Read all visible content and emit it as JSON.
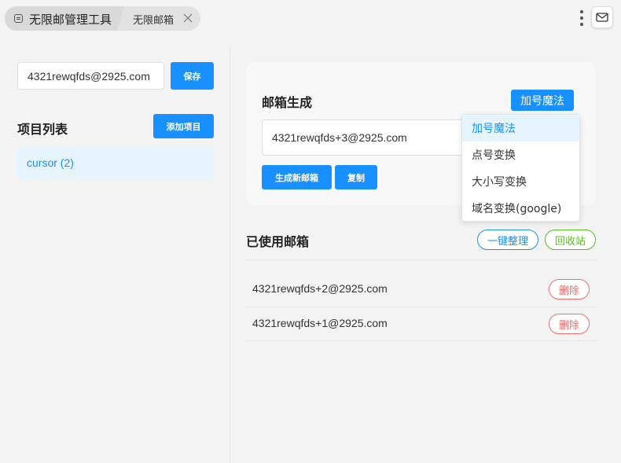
{
  "tabs": {
    "main_label": "无限邮管理工具",
    "sub_label": "无限邮箱"
  },
  "sidebar": {
    "email_value": "4321rewqfds@2925.com",
    "save_label": "保存",
    "projects_title": "项目列表",
    "add_project_label": "添加项目",
    "projects": [
      {
        "label": "cursor (2)"
      }
    ]
  },
  "generator": {
    "title": "邮箱生成",
    "mode_button_label": "加号魔法",
    "generated_email": "4321rewqfds+3@2925.com",
    "generate_label": "生成新邮箱",
    "copy_label": "复制",
    "dropdown_options": [
      "加号魔法",
      "点号变换",
      "大小写变换",
      "域名变换(google)"
    ],
    "selected_option": "加号魔法"
  },
  "used": {
    "title": "已使用邮箱",
    "organize_label": "一键整理",
    "recycle_label": "回收站",
    "delete_label": "删除",
    "rows": [
      {
        "email": "4321rewqfds+2@2925.com"
      },
      {
        "email": "4321rewqfds+1@2925.com"
      }
    ]
  },
  "icons": {
    "app": "app-icon",
    "close": "close-icon",
    "menu": "more-vertical-icon",
    "mail": "mail-icon"
  },
  "colors": {
    "primary": "#1890ff",
    "success": "#52c41a",
    "danger": "#f56c6c",
    "active_bg": "#e6f4fd"
  }
}
